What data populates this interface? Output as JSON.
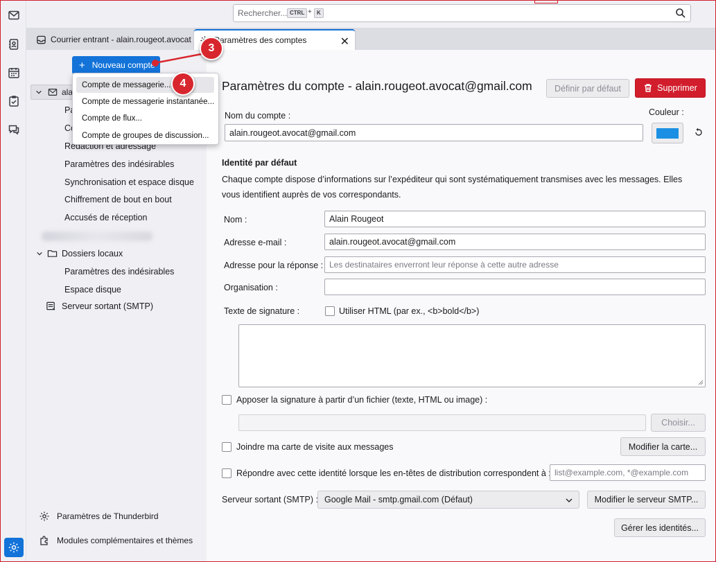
{
  "search": {
    "placeholder": "Rechercher...",
    "kbd_ctrl": "CTRL",
    "kbd_plus": "+",
    "kbd_k": "K"
  },
  "tabs": [
    {
      "label": "Courrier entrant - alain.rougeot.avocat"
    },
    {
      "label": "Paramètres des comptes",
      "close": "✕"
    }
  ],
  "sidebar": {
    "new_account_label": "Nouveau compte",
    "new_account_plus": "+",
    "account_name": "ala",
    "account_items": [
      "Pa",
      "Co",
      "Rédaction et adressage",
      "Paramètres des indésirables",
      "Synchronisation et espace disque",
      "Chiffrement de bout en bout",
      "Accusés de réception"
    ],
    "local_folders": "Dossiers locaux",
    "local_items": [
      "Paramètres des indésirables",
      "Espace disque"
    ],
    "smtp": "Serveur sortant (SMTP)",
    "footer": [
      "Paramètres de Thunderbird",
      "Modules complémentaires et thèmes"
    ]
  },
  "menu": {
    "items": [
      "Compte de messagerie...",
      "Compte de messagerie instantanée...",
      "Compte de flux...",
      "Compte de groupes de discussion..."
    ]
  },
  "callouts": [
    "3",
    "4"
  ],
  "main": {
    "title": "Paramètres du compte - alain.rougeot.avocat@gmail.com",
    "set_default": "Définir par défaut",
    "delete": "Supprimer",
    "account_name_label": "Nom du compte :",
    "account_name_value": "alain.rougeot.avocat@gmail.com",
    "color_label": "Couleur :",
    "identity_heading": "Identité par défaut",
    "identity_desc": "Chaque compte dispose d’informations sur l’expéditeur qui sont systématiquement transmises avec les messages. Elles vous identifient auprès de vos correspondants.",
    "name_label": "Nom :",
    "name_value": "Alain Rougeot",
    "email_label": "Adresse e-mail :",
    "email_value": "alain.rougeot.avocat@gmail.com",
    "reply_label": "Adresse pour la réponse :",
    "reply_placeholder": "Les destinataires enverront leur réponse à cette autre adresse",
    "org_label": "Organisation :",
    "org_value": "",
    "sig_label": "Texte de signature :",
    "sig_html": "Utiliser HTML (par ex., <b>bold</b>)",
    "sig_file": "Apposer la signature à partir d’un fichier (texte, HTML ou image) :",
    "choose": "Choisir...",
    "vcard": "Joindre ma carte de visite aux messages",
    "edit_card": "Modifier la carte...",
    "reply_identity": "Répondre avec cette identité lorsque les en-têtes de distribution correspondent à :",
    "reply_identity_placeholder": "list@example.com, *@example.com",
    "smtp_label": "Serveur sortant (SMTP) :",
    "smtp_value": "Google Mail - smtp.gmail.com (Défaut)",
    "smtp_edit": "Modifier le serveur SMTP...",
    "manage_ids": "Gérer les identités..."
  },
  "colors": {
    "accent": "#1373d9",
    "danger": "#d21d2c",
    "swatch": "#1a8fe3"
  }
}
